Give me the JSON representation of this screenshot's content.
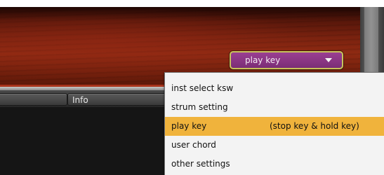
{
  "tabs": {
    "left_label": "",
    "info_label": "Info"
  },
  "combo": {
    "selected": "play key",
    "arrow_icon": "triangle-down-icon",
    "fill_color": "#8a3683",
    "border_color": "#c8c25a"
  },
  "menu": {
    "highlight_color": "#f0b33c",
    "items": [
      {
        "label": "inst select ksw",
        "shortcut": ""
      },
      {
        "label": "strum setting",
        "shortcut": ""
      },
      {
        "label": "play key",
        "shortcut": "(stop key & hold key)"
      },
      {
        "label": "user chord",
        "shortcut": ""
      },
      {
        "label": "other settings",
        "shortcut": ""
      }
    ],
    "selected_index": 2
  }
}
